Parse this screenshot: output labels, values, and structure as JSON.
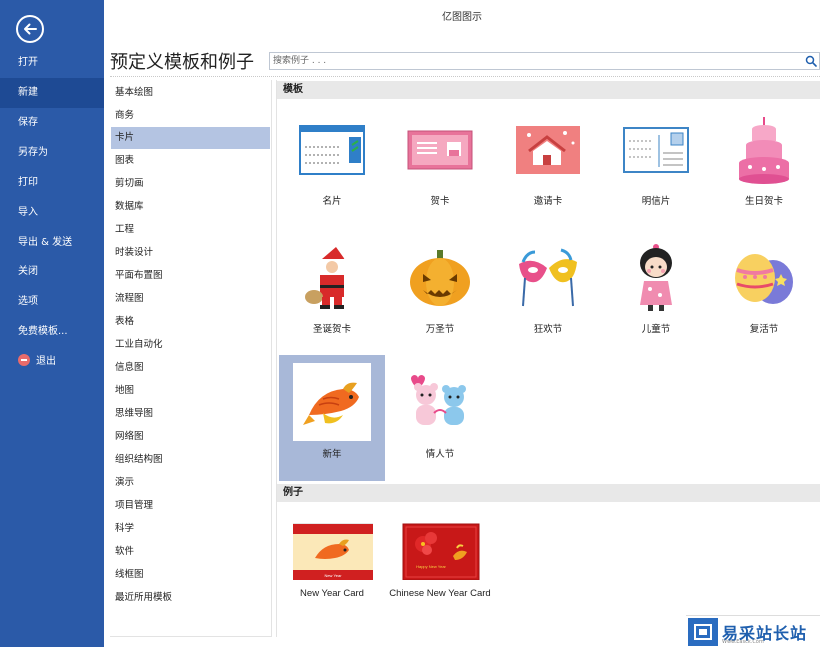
{
  "window": {
    "title": "亿图图示"
  },
  "backstage": {
    "items": [
      {
        "label": "打开",
        "name": "menu-open"
      },
      {
        "label": "新建",
        "name": "menu-new",
        "active": true
      },
      {
        "label": "保存",
        "name": "menu-save"
      },
      {
        "label": "另存为",
        "name": "menu-save-as"
      },
      {
        "label": "打印",
        "name": "menu-print"
      },
      {
        "label": "导入",
        "name": "menu-import"
      },
      {
        "label": "导出 & 发送",
        "name": "menu-export-send"
      },
      {
        "label": "关闭",
        "name": "menu-close"
      },
      {
        "label": "选项",
        "name": "menu-options"
      },
      {
        "label": "免费模板...",
        "name": "menu-free-templates"
      },
      {
        "label": "退出",
        "name": "menu-exit",
        "icon": "exit-icon"
      }
    ],
    "back_icon": "back-arrow-icon"
  },
  "header": {
    "title": "预定义模板和例子",
    "search_placeholder": "搜索例子 . . .",
    "search_icon": "search-icon"
  },
  "categories": [
    "基本绘图",
    "商务",
    "卡片",
    "图表",
    "剪切画",
    "数据库",
    "工程",
    "时装设计",
    "平面布置图",
    "流程图",
    "表格",
    "工业自动化",
    "信息图",
    "地图",
    "思维导图",
    "网络图",
    "组织结构图",
    "演示",
    "项目管理",
    "科学",
    "软件",
    "线框图",
    "最近所用模板"
  ],
  "selected_category": "卡片",
  "templates": {
    "header": "模板",
    "items": [
      {
        "label": "名片",
        "icon": "business-card-icon"
      },
      {
        "label": "贺卡",
        "icon": "greeting-card-icon"
      },
      {
        "label": "邀请卡",
        "icon": "invitation-card-icon"
      },
      {
        "label": "明信片",
        "icon": "postcard-icon"
      },
      {
        "label": "生日贺卡",
        "icon": "birthday-cake-icon"
      },
      {
        "label": "圣诞贺卡",
        "icon": "santa-claus-icon"
      },
      {
        "label": "万圣节",
        "icon": "pumpkin-icon"
      },
      {
        "label": "狂欢节",
        "icon": "carnival-mask-icon"
      },
      {
        "label": "儿童节",
        "icon": "kid-doll-icon"
      },
      {
        "label": "复活节",
        "icon": "easter-egg-icon"
      },
      {
        "label": "新年",
        "icon": "new-year-fish-icon",
        "selected": true
      },
      {
        "label": "情人节",
        "icon": "valentine-bears-icon"
      }
    ]
  },
  "examples": {
    "header": "例子",
    "items": [
      {
        "label": "New Year Card",
        "icon": "new-year-card-thumbnail"
      },
      {
        "label": "Chinese New Year Card",
        "icon": "chinese-new-year-card-thumbnail"
      }
    ]
  },
  "watermark": {
    "text": "易采站长站",
    "sub": "Www.Easck.Com"
  },
  "colors": {
    "backstage": "#2b5aa8",
    "backstage_active": "#1e4a94",
    "selection": "#b4c4e2",
    "tile_selected": "#a8b8d8"
  }
}
